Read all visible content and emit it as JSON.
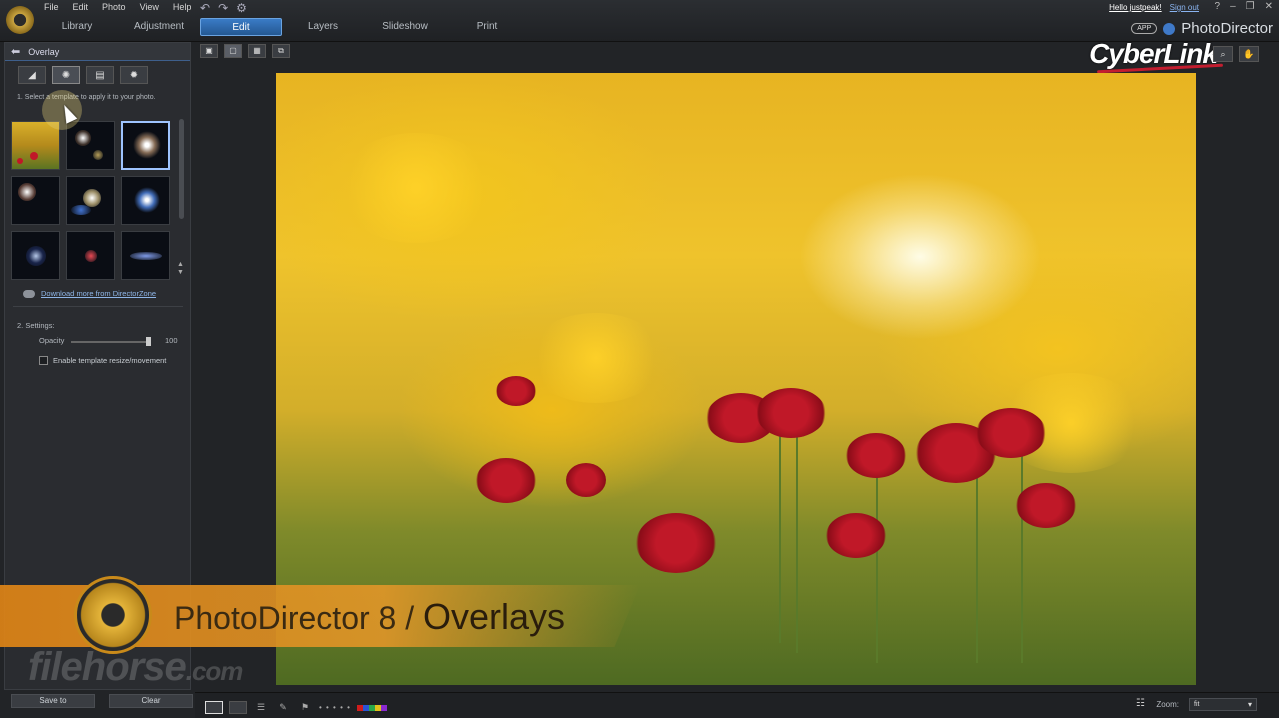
{
  "menu": [
    "File",
    "Edit",
    "Photo",
    "View",
    "Help"
  ],
  "modules": [
    {
      "label": "Library",
      "active": false
    },
    {
      "label": "Adjustment",
      "active": false
    },
    {
      "label": "Edit",
      "active": true
    },
    {
      "label": "Layers",
      "active": false
    },
    {
      "label": "Slideshow",
      "active": false
    },
    {
      "label": "Print",
      "active": false
    }
  ],
  "account": {
    "greeting": "Hello justpeak!",
    "signout": "Sign out"
  },
  "brand": {
    "badge": "APP",
    "name": "PhotoDirector",
    "vendor": "CyberLink"
  },
  "panel": {
    "title": "Overlay",
    "hint": "1. Select a template to apply it to your photo.",
    "download_link": "Download more from DirectorZone",
    "settings_title": "2. Settings:",
    "opacity_label": "Opacity",
    "opacity_value": "100",
    "checkbox_label": "Enable template resize/movement",
    "save_label": "Save to",
    "clear_label": "Clear"
  },
  "banner": {
    "title": "PhotoDirector 8",
    "separator": "/",
    "subtitle": "Overlays"
  },
  "watermark": {
    "name": "filehorse",
    "suffix": ".com"
  },
  "bottombar": {
    "zoom_label": "Zoom:",
    "zoom_value": "fit"
  },
  "colors": {
    "accent": "#3a7bc6",
    "banner": "#de8416",
    "swatches": [
      "#d01c1c",
      "#2a55d6",
      "#2aa84a",
      "#e2c01a",
      "#8a2ad0"
    ]
  }
}
